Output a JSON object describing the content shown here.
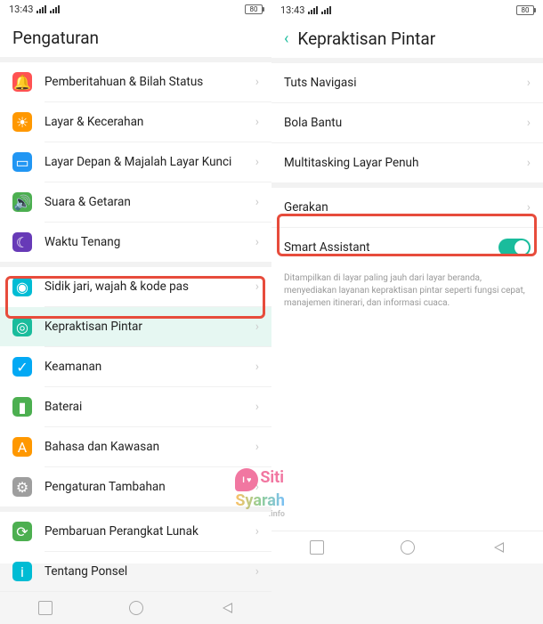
{
  "statusBar": {
    "time": "13:43",
    "battery": "80"
  },
  "left": {
    "title": "Pengaturan",
    "items": [
      {
        "label": "Pemberitahuan & Bilah Status"
      },
      {
        "label": "Layar &  Kecerahan"
      },
      {
        "label": "Layar Depan & Majalah Layar Kunci"
      },
      {
        "label": "Suara & Getaran"
      },
      {
        "label": "Waktu Tenang"
      },
      {
        "label": "Sidik jari, wajah & kode pas"
      },
      {
        "label": "Kepraktisan Pintar"
      },
      {
        "label": "Keamanan"
      },
      {
        "label": "Baterai"
      },
      {
        "label": "Bahasa dan Kawasan"
      },
      {
        "label": "Pengaturan Tambahan"
      },
      {
        "label": "Pembaruan Perangkat Lunak"
      },
      {
        "label": "Tentang Ponsel"
      }
    ]
  },
  "right": {
    "title": "Kepraktisan Pintar",
    "items": [
      {
        "label": "Tuts Navigasi"
      },
      {
        "label": "Bola Bantu"
      },
      {
        "label": "Multitasking Layar Penuh"
      },
      {
        "label": "Gerakan"
      },
      {
        "label": "Smart Assistant"
      }
    ],
    "desc": "Ditampilkan di layar paling jauh dari layar beranda, menyediakan layanan kepraktisan pintar seperti fungsi cepat, manajemen itinerari, dan informasi cuaca."
  },
  "watermark": {
    "line1": "Siti",
    "line2": "Syarah",
    "sub": ".info",
    "bubble": "I ♥"
  }
}
